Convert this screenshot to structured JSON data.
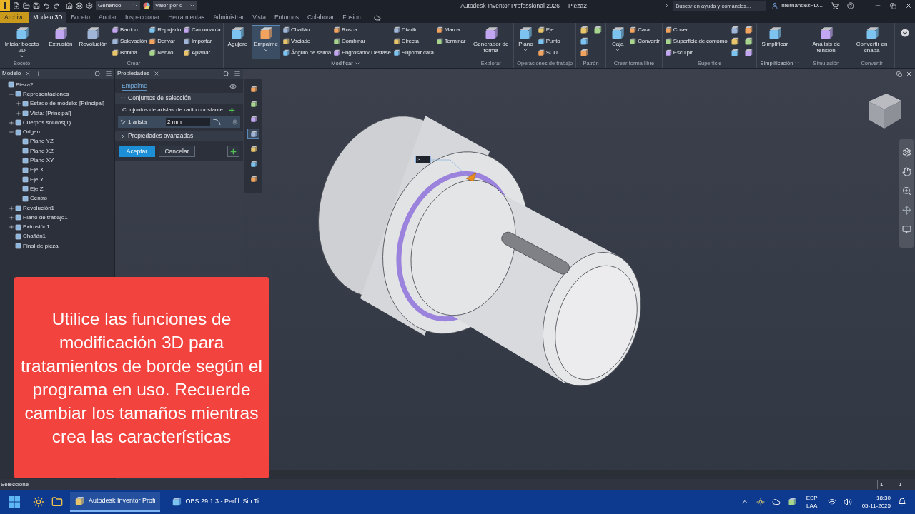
{
  "title_bar": {
    "style_field": "Genérico",
    "appearance_field": "Valor por d",
    "title": "Autodesk Inventor Professional 2026",
    "document": "Pieza2",
    "search": {
      "placeholder": "Buscar en ayuda y comandos..."
    },
    "user": "nfernandezPD..."
  },
  "ribbon_tabs": [
    {
      "label": "Archivo",
      "kind": "file",
      "selected": false
    },
    {
      "label": "Modelo 3D",
      "kind": "tab",
      "selected": true
    },
    {
      "label": "Boceto",
      "kind": "tab",
      "selected": false
    },
    {
      "label": "Anotar",
      "kind": "tab",
      "selected": false
    },
    {
      "label": "Inspeccionar",
      "kind": "tab",
      "selected": false
    },
    {
      "label": "Herramientas",
      "kind": "tab",
      "selected": false
    },
    {
      "label": "Administrar",
      "kind": "tab",
      "selected": false
    },
    {
      "label": "Vista",
      "kind": "tab",
      "selected": false
    },
    {
      "label": "Entornos",
      "kind": "tab",
      "selected": false
    },
    {
      "label": "Colaborar",
      "kind": "tab",
      "selected": false
    },
    {
      "label": "Fusion",
      "kind": "tab",
      "selected": false
    }
  ],
  "ribbon_groups": [
    {
      "label": "Boceto",
      "dropdown": false,
      "items": [
        {
          "kind": "large",
          "label": "Iniciar boceto 2D",
          "dropdown": true,
          "selected": false
        }
      ]
    },
    {
      "label": "Crear",
      "dropdown": false,
      "items": [
        {
          "kind": "large",
          "label": "Extrusión",
          "selected": false
        },
        {
          "kind": "large",
          "label": "Revolución",
          "selected": false
        },
        {
          "kind": "small",
          "label": "Barrido"
        },
        {
          "kind": "small",
          "label": "Solevación"
        },
        {
          "kind": "small",
          "label": "Bobina"
        },
        {
          "kind": "small",
          "label": "Repujado"
        },
        {
          "kind": "small",
          "label": "Derivar"
        },
        {
          "kind": "small",
          "label": "Nervio"
        },
        {
          "kind": "small",
          "label": "Calcomanía"
        },
        {
          "kind": "small",
          "label": "Importar"
        },
        {
          "kind": "small",
          "label": "Aplanar"
        }
      ]
    },
    {
      "label": "Modificar",
      "dropdown": true,
      "items": [
        {
          "kind": "large",
          "label": "Agujero",
          "selected": false
        },
        {
          "kind": "large",
          "label": "Empalme",
          "dropdown": true,
          "selected": true
        },
        {
          "kind": "small",
          "label": "Chaflán"
        },
        {
          "kind": "small",
          "label": "Vaciado"
        },
        {
          "kind": "small",
          "label": "Ángulo de salida"
        },
        {
          "kind": "small",
          "label": "Rosca"
        },
        {
          "kind": "small",
          "label": "Combinar"
        },
        {
          "kind": "small",
          "label": "Engrosado/ Desfase"
        },
        {
          "kind": "small",
          "label": "Dividir"
        },
        {
          "kind": "small",
          "label": "Directa"
        },
        {
          "kind": "small",
          "label": "Suprimir cara"
        },
        {
          "kind": "small",
          "label": "Marca"
        },
        {
          "kind": "small",
          "label": "Terminar"
        }
      ]
    },
    {
      "label": "Explorar",
      "dropdown": false,
      "items": [
        {
          "kind": "large",
          "label": "Generador de forma",
          "selected": false
        }
      ]
    },
    {
      "label": "Operaciones de trabajo",
      "dropdown": false,
      "items": [
        {
          "kind": "large",
          "label": "Plano",
          "dropdown": true,
          "selected": false
        },
        {
          "kind": "small",
          "label": "Eje"
        },
        {
          "kind": "small",
          "label": "Punto"
        },
        {
          "kind": "small",
          "label": "SCU"
        }
      ]
    },
    {
      "label": "Patrón",
      "dropdown": false,
      "items": [
        {
          "kind": "icon"
        },
        {
          "kind": "icon"
        },
        {
          "kind": "icon"
        },
        {
          "kind": "icon"
        }
      ]
    },
    {
      "label": "Crear forma libre",
      "dropdown": false,
      "items": [
        {
          "kind": "large",
          "label": "Caja",
          "dropdown": true,
          "selected": false
        },
        {
          "kind": "small",
          "label": "Cara"
        },
        {
          "kind": "small",
          "label": "Convertir"
        }
      ]
    },
    {
      "label": "Superficie",
      "dropdown": false,
      "items": [
        {
          "kind": "small",
          "label": "Coser"
        },
        {
          "kind": "small",
          "label": "Superficie de contorno"
        },
        {
          "kind": "small",
          "label": "Esculpir"
        },
        {
          "kind": "icon"
        },
        {
          "kind": "icon"
        },
        {
          "kind": "icon"
        },
        {
          "kind": "icon"
        },
        {
          "kind": "icon"
        },
        {
          "kind": "icon"
        }
      ]
    },
    {
      "label": "Simplificación",
      "dropdown": true,
      "items": [
        {
          "kind": "large",
          "label": "Simplificar",
          "selected": false
        }
      ]
    },
    {
      "label": "Simulación",
      "dropdown": false,
      "items": [
        {
          "kind": "large",
          "label": "Análisis de tensión",
          "selected": false
        }
      ]
    },
    {
      "label": "Convertir",
      "dropdown": false,
      "items": [
        {
          "kind": "large",
          "label": "Convertir en chapa",
          "selected": false
        }
      ]
    }
  ],
  "model_browser": {
    "tab": "Modelo",
    "tree": [
      {
        "label": "Pieza2",
        "children": [
          {
            "label": "Representaciones",
            "expanded": true,
            "children": [
              {
                "label": "Estado de modelo: [Principal]",
                "expanded": false
              },
              {
                "label": "Vista: [Principal]",
                "expanded": false
              }
            ]
          },
          {
            "label": "Cuerpos sólidos(1)",
            "expanded": false
          },
          {
            "label": "Origen",
            "expanded": true,
            "children": [
              {
                "label": "Plano YZ"
              },
              {
                "label": "Plano XZ"
              },
              {
                "label": "Plano XY"
              },
              {
                "label": "Eje X"
              },
              {
                "label": "Eje Y"
              },
              {
                "label": "Eje Z"
              },
              {
                "label": "Centro"
              }
            ]
          },
          {
            "label": "Revolución1",
            "expanded": false
          },
          {
            "label": "Plano de trabajo1",
            "expanded": false
          },
          {
            "label": "Extrusión1",
            "expanded": false
          },
          {
            "label": "Chaflán1"
          },
          {
            "label": "Final de pieza"
          }
        ]
      }
    ]
  },
  "properties": {
    "tab": "Propiedades",
    "feature": "Empalme",
    "selection_section": {
      "label": "Conjuntos de selección",
      "expanded": true
    },
    "edge_set_label": "Conjuntos de aristas de radio constante",
    "edge_row": {
      "label": "1 arista",
      "radius": "2 mm",
      "selected": true
    },
    "advanced_section": {
      "label": "Propiedades avanzadas",
      "expanded": false
    },
    "buttons": [
      {
        "label": "Aceptar",
        "kind": "primary"
      },
      {
        "label": "Cancelar",
        "kind": "secondary"
      }
    ]
  },
  "viewport": {
    "dimension_tag": "3"
  },
  "caption": "Utilice las funciones de modificación 3D para tratamientos de borde según el programa en uso. Recuerde cambiar los tamaños mientras crea las características",
  "status_bar": {
    "message": "Seleccione",
    "counters": [
      "1",
      "1"
    ]
  },
  "taskbar": {
    "apps": [
      {
        "label": "Autodesk Inventor Profi",
        "selected": true
      },
      {
        "label": "OBS 29.1.3 - Perfil: Sin Ti",
        "selected": false
      }
    ],
    "language": "ESP",
    "region": "LAA",
    "time": "18:30",
    "date": "05-11-2025"
  }
}
